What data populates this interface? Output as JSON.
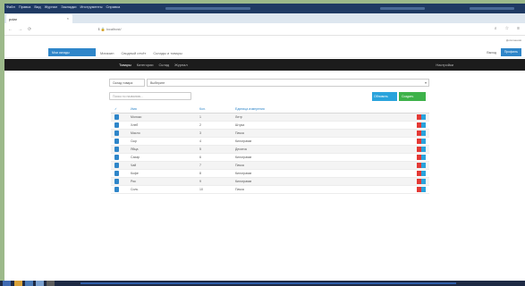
{
  "browser": {
    "menus": [
      "Файл",
      "Правка",
      "Вид",
      "Журнал",
      "Закладки",
      "Инструменты",
      "Справка"
    ],
    "tab_title": "polar",
    "tab_close": "×",
    "url": "ℹ 🔒 localhost/",
    "extensions_hint": "Дополнения"
  },
  "app": {
    "brand": "Мои склады",
    "topnav": [
      "Магазин",
      "Сводный отчёт",
      "Склады и товары"
    ],
    "user": "Выход",
    "top_button": "Профиль"
  },
  "subnav": {
    "items": [
      "Товары",
      "Категории",
      "Склад",
      "Журнал"
    ],
    "right": "Настройки"
  },
  "filters": {
    "label": "Склад товара",
    "selected": "Выберите",
    "search_placeholder": "Поиск по названию..."
  },
  "actions": {
    "button1": "Обновить",
    "button2": "Создать"
  },
  "table": {
    "headers": [
      "Имя",
      "Кол.",
      "Единица измерения"
    ],
    "rows": [
      {
        "name": "Молоко",
        "qty": "1",
        "unit": "Литр"
      },
      {
        "name": "Хлеб",
        "qty": "2",
        "unit": "Штука"
      },
      {
        "name": "Масло",
        "qty": "3",
        "unit": "Пачка"
      },
      {
        "name": "Сыр",
        "qty": "4",
        "unit": "Килограмм"
      },
      {
        "name": "Яйца",
        "qty": "5",
        "unit": "Десяток"
      },
      {
        "name": "Сахар",
        "qty": "6",
        "unit": "Килограмм"
      },
      {
        "name": "Чай",
        "qty": "7",
        "unit": "Пачка"
      },
      {
        "name": "Кофе",
        "qty": "8",
        "unit": "Килограмм"
      },
      {
        "name": "Рис",
        "qty": "9",
        "unit": "Килограмм"
      },
      {
        "name": "Соль",
        "qty": "10",
        "unit": "Пачка"
      }
    ]
  },
  "colors": {
    "accent": "#2f86c9",
    "danger": "#e53935",
    "success": "#3eb24a",
    "info": "#2aa3dc"
  }
}
